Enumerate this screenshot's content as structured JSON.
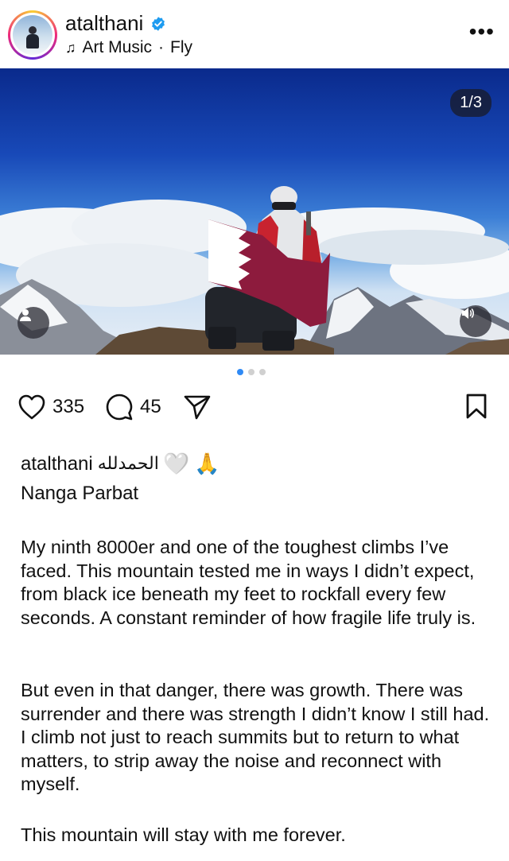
{
  "post": {
    "username": "atalthani",
    "verified": true,
    "music": "Art Music",
    "location_sep": "·",
    "song": "Fly",
    "image_counter": "1/3",
    "carousel": {
      "total": 3,
      "active": 1
    }
  },
  "actions": {
    "likes": "335",
    "comments": "45"
  },
  "caption": {
    "username": "atalthani",
    "arabic": "الحمدلله",
    "emoji_heart": "🤍",
    "emoji_pray": "🙏",
    "title": "Nanga Parbat",
    "paragraphs": [
      "My ninth 8000er and one of the toughest climbs I’ve faced. This mountain tested me in ways I didn’t expect, from black ice beneath my feet to rockfall every few seconds. A constant reminder of how fragile life truly is.",
      "But even in that danger, there was growth. There was surrender and there was strength I didn’t know I still had. I climb not just to reach summits but to return to what matters, to strip away the noise and reconnect with myself.",
      "This mountain will stay with me forever."
    ]
  },
  "icons": {
    "verified": "verified-badge-icon",
    "music": "music-note-icon",
    "more": "more-horizontal-icon",
    "like": "heart-outline-icon",
    "comment": "comment-bubble-icon",
    "share": "paper-plane-icon",
    "save": "bookmark-icon",
    "tag": "person-tag-icon",
    "sound": "speaker-icon"
  },
  "colors": {
    "verified": "#1d9bf0",
    "carousel_active": "#2f8af5",
    "carousel_inactive": "#d0d0d0"
  }
}
